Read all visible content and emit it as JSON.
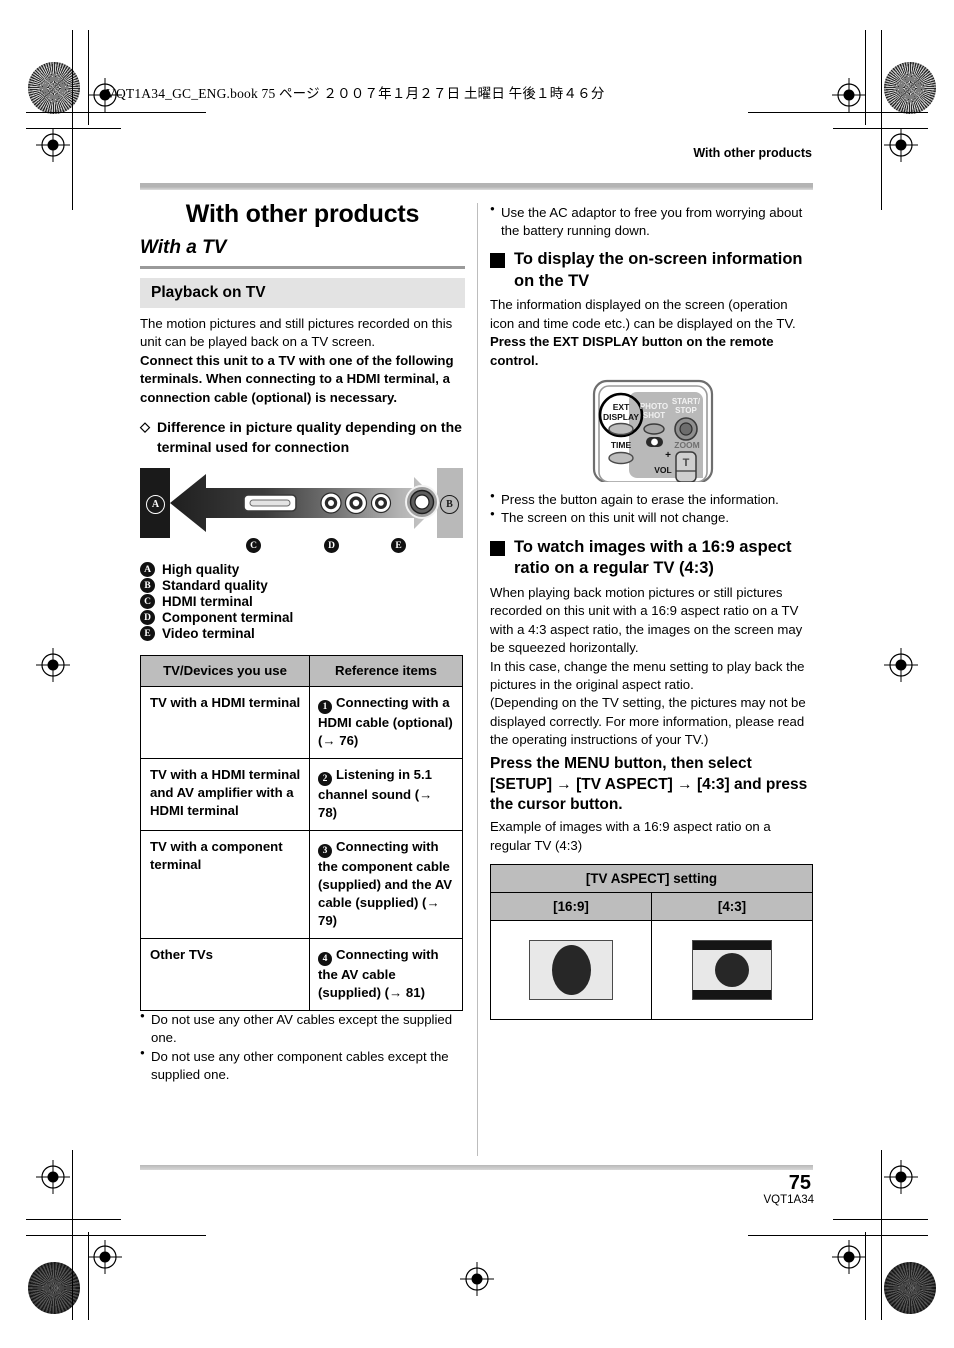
{
  "print_header": "VQT1A34_GC_ENG.book   75 ページ   ２００７年１月２７日   土曜日   午後１時４６分",
  "running_head": "With other products",
  "footer": {
    "page_number": "75",
    "doc_code": "VQT1A34"
  },
  "left_column": {
    "chapter_title": "With other products",
    "section_title": "With a TV",
    "grey_heading": "Playback on TV",
    "intro_normal": "The motion pictures and still pictures recorded on this unit can be played back on a TV screen.",
    "intro_bold": "Connect this unit to a TV with one of the following terminals. When connecting to a HDMI terminal, a connection cable (optional) is necessary.",
    "diamond_heading": "Difference in picture quality depending on the terminal used for connection",
    "diagram": {
      "badge_a": "A",
      "badge_b": "B",
      "badge_c": "C",
      "badge_d": "D",
      "badge_e": "E"
    },
    "legend": [
      {
        "key": "A",
        "label": "High quality"
      },
      {
        "key": "B",
        "label": "Standard quality"
      },
      {
        "key": "C",
        "label": "HDMI terminal"
      },
      {
        "key": "D",
        "label": "Component terminal"
      },
      {
        "key": "E",
        "label": "Video terminal"
      }
    ],
    "table": {
      "headers": [
        "TV/Devices you use",
        "Reference items"
      ],
      "rows": [
        {
          "device": "TV with a HDMI terminal",
          "num": "1",
          "ref": "Connecting with a HDMI cable (optional) (→ 76)"
        },
        {
          "device": "TV with a HDMI terminal and AV amplifier with a HDMI terminal",
          "num": "2",
          "ref": "Listening in 5.1 channel sound (→ 78)"
        },
        {
          "device": "TV with a component terminal",
          "num": "3",
          "ref": "Connecting with the component cable (supplied) and the AV cable (supplied) (→ 79)"
        },
        {
          "device": "Other TVs",
          "num": "4",
          "ref": "Connecting with the AV cable (supplied) (→ 81)"
        }
      ]
    },
    "notes": [
      "Do not use any other AV cables except the supplied one.",
      "Do not use any other component cables except the supplied one."
    ]
  },
  "right_column": {
    "top_note": "Use the AC adaptor to free you from worrying about the battery running down.",
    "heading_1": "To display the on-screen information on the TV",
    "body_1": "The information displayed on the screen (operation icon and time code etc.) can be displayed on the TV.",
    "body_1_bold": "Press the EXT DISPLAY button on the remote control.",
    "remote": {
      "ext_display_line1": "EXT",
      "ext_display_line2": "DISPLAY",
      "photo_shot_line1": "PHOTO",
      "photo_shot_line2": "SHOT",
      "start_stop_line1": "START/",
      "start_stop_line2": "STOP",
      "time_label": "TIME",
      "zoom_label": "ZOOM",
      "vol_label": "VOL",
      "plus_label": "+",
      "tele_label": "T"
    },
    "notes": [
      "Press the button again to erase the information.",
      "The screen on this unit will not change."
    ],
    "heading_2": "To watch images with a 16:9 aspect ratio on a regular TV (4:3)",
    "body_2": "When playing back motion pictures or still pictures recorded on this unit with a 16:9 aspect ratio on a TV with a 4:3 aspect ratio, the images on the screen may be squeezed horizontally.\nIn this case, change the menu setting to play back the pictures in the original aspect ratio.\n(Depending on the TV setting, the pictures may not be displayed correctly. For more information, please read the operating instructions of your TV.)",
    "instruction_bold": "Press the MENU button, then select [SETUP] → [TV ASPECT] → [4:3] and press the cursor button.",
    "example_caption": "Example of images with a 16:9 aspect ratio on a regular TV (4:3)",
    "aspect_table": {
      "title": "[TV ASPECT] setting",
      "col1": "[16:9]",
      "col2": "[4:3]"
    }
  }
}
